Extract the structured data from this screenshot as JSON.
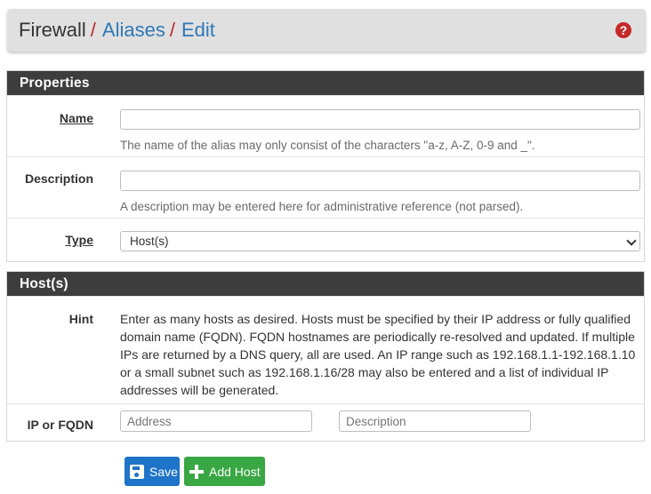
{
  "breadcrumb": {
    "root": "Firewall",
    "sep1": "/",
    "item2": "Aliases",
    "sep2": "/",
    "item3": "Edit",
    "help_glyph": "?"
  },
  "properties": {
    "heading": "Properties",
    "name_label": "Name",
    "name_value": "",
    "name_help": "The name of the alias may only consist of the characters \"a-z, A-Z, 0-9 and _\".",
    "description_label": "Description",
    "description_value": "",
    "description_help": "A description may be entered here for administrative reference (not parsed).",
    "type_label": "Type",
    "type_selected": "Host(s)"
  },
  "hosts": {
    "heading": "Host(s)",
    "hint_label": "Hint",
    "hint_text": "Enter as many hosts as desired. Hosts must be specified by their IP address or fully qualified domain name (FQDN). FQDN hostnames are periodically re-resolved and updated. If multiple IPs are returned by a DNS query, all are used. An IP range such as 192.168.1.1-192.168.1.10 or a small subnet such as 192.168.1.16/28 may also be entered and a list of individual IP addresses will be generated.",
    "ip_label": "IP or FQDN",
    "address_placeholder": "Address",
    "description_placeholder": "Description"
  },
  "actions": {
    "save_label": "Save",
    "add_host_label": "Add Host"
  },
  "colors": {
    "header_bg": "#e0e0e0",
    "panel_heading_bg": "#3d3d3d",
    "link": "#2f78b8",
    "separator": "#b52828",
    "save_button": "#1e74c8",
    "add_button": "#39a743"
  },
  "icons": {
    "help": "question-circle-icon",
    "save": "floppy-disk-icon",
    "add": "plus-icon",
    "select": "chevron-down-icon"
  }
}
